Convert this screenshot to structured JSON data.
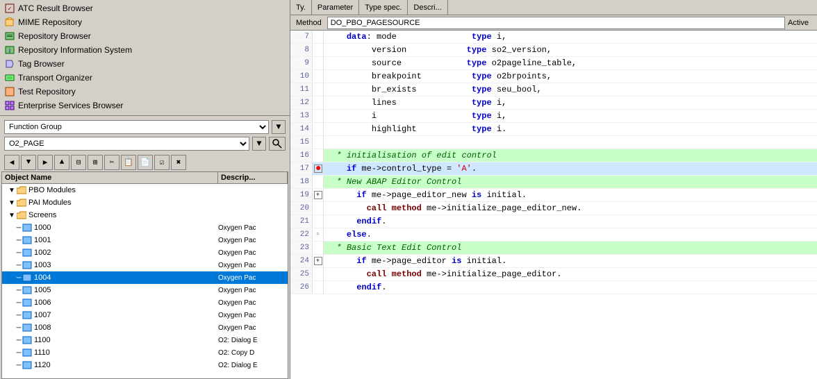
{
  "nav": {
    "items": [
      {
        "id": "atc",
        "label": "ATC Result Browser",
        "icon": "✓"
      },
      {
        "id": "mime",
        "label": "MIME Repository",
        "icon": "📁"
      },
      {
        "id": "repo",
        "label": "Repository Browser",
        "icon": "🗄"
      },
      {
        "id": "repoinfo",
        "label": "Repository Information System",
        "icon": "ℹ"
      },
      {
        "id": "tag",
        "label": "Tag Browser",
        "icon": "🏷"
      },
      {
        "id": "transport",
        "label": "Transport Organizer",
        "icon": "📦"
      },
      {
        "id": "test",
        "label": "Test Repository",
        "icon": "🧪"
      },
      {
        "id": "enterprise",
        "label": "Enterprise Services Browser",
        "icon": "⚙"
      }
    ]
  },
  "filter": {
    "type_label": "Function Group",
    "type_value": "Function Group",
    "object_value": "O2_PAGE",
    "search_label": "🔍"
  },
  "toolbar": {
    "buttons": [
      "◀",
      "▶",
      "▲",
      "▼",
      "⊟",
      "⊞",
      "📋",
      "⊞",
      "🗑"
    ]
  },
  "tree": {
    "col_name": "Object Name",
    "col_desc": "Descrip...",
    "items": [
      {
        "level": 1,
        "expand": true,
        "icon": "📁",
        "label": "PBO Modules",
        "desc": "",
        "type": "folder"
      },
      {
        "level": 1,
        "expand": true,
        "icon": "📁",
        "label": "PAI Modules",
        "desc": "",
        "type": "folder"
      },
      {
        "level": 1,
        "expand": true,
        "icon": "📁",
        "label": "Screens",
        "desc": "",
        "type": "folder"
      },
      {
        "level": 2,
        "expand": false,
        "icon": "📄",
        "label": "1000",
        "desc": "Oxygen Pac",
        "type": "item"
      },
      {
        "level": 2,
        "expand": false,
        "icon": "📄",
        "label": "1001",
        "desc": "Oxygen Pac",
        "type": "item"
      },
      {
        "level": 2,
        "expand": false,
        "icon": "📄",
        "label": "1002",
        "desc": "Oxygen Pac",
        "type": "item"
      },
      {
        "level": 2,
        "expand": false,
        "icon": "📄",
        "label": "1003",
        "desc": "Oxygen Pac",
        "type": "item"
      },
      {
        "level": 2,
        "expand": false,
        "icon": "📄",
        "label": "1004",
        "desc": "Oxygen Pac",
        "type": "item",
        "selected": true
      },
      {
        "level": 2,
        "expand": false,
        "icon": "📄",
        "label": "1005",
        "desc": "Oxygen Pac",
        "type": "item"
      },
      {
        "level": 2,
        "expand": false,
        "icon": "📄",
        "label": "1006",
        "desc": "Oxygen Pac",
        "type": "item"
      },
      {
        "level": 2,
        "expand": false,
        "icon": "📄",
        "label": "1007",
        "desc": "Oxygen Pac",
        "type": "item"
      },
      {
        "level": 2,
        "expand": false,
        "icon": "📄",
        "label": "1008",
        "desc": "Oxygen Pac",
        "type": "item"
      },
      {
        "level": 2,
        "expand": false,
        "icon": "📄",
        "label": "1100",
        "desc": "O2: Dialog E",
        "type": "item"
      },
      {
        "level": 2,
        "expand": false,
        "icon": "📄",
        "label": "1110",
        "desc": "O2: Copy D",
        "type": "item"
      },
      {
        "level": 2,
        "expand": false,
        "icon": "📄",
        "label": "1120",
        "desc": "O2: Dialog E",
        "type": "item"
      }
    ]
  },
  "editor": {
    "tabs": [
      {
        "id": "ty",
        "label": "Ty."
      },
      {
        "id": "param",
        "label": "Parameter"
      },
      {
        "id": "typespec",
        "label": "Type spec."
      },
      {
        "id": "descri",
        "label": "Descri..."
      }
    ],
    "method_label": "Method",
    "method_value": "DO_PBO_PAGESOURCE",
    "active_label": "Active",
    "lines": [
      {
        "num": "7",
        "fold": "",
        "content": "    <kw>data</kw>: mode               <kw>type</kw> i,"
      },
      {
        "num": "8",
        "fold": "",
        "content": "         version            <kw>type</kw> so2_version,"
      },
      {
        "num": "9",
        "fold": "",
        "content": "         source             <kw>type</kw> o2pageline_table,"
      },
      {
        "num": "10",
        "fold": "",
        "content": "         breakpoint          <kw>type</kw> o2brpoints,"
      },
      {
        "num": "11",
        "fold": "",
        "content": "         br_exists           <kw>type</kw> seu_bool,"
      },
      {
        "num": "12",
        "fold": "",
        "content": "         lines               <kw>type</kw> i,"
      },
      {
        "num": "13",
        "fold": "",
        "content": "         i                   <kw>type</kw> i,"
      },
      {
        "num": "14",
        "fold": "",
        "content": "         highlight           <kw>type</kw> i."
      },
      {
        "num": "15",
        "fold": "",
        "content": ""
      },
      {
        "num": "16",
        "fold": "",
        "content": "  * initialisation of edit control",
        "style": "comment"
      },
      {
        "num": "17",
        "fold": "-",
        "content": "    <kw>if</kw> me->control_type = <str>'A'</str>.",
        "error": true
      },
      {
        "num": "18",
        "fold": "",
        "content": "  * New ABAP Editor Control",
        "style": "comment"
      },
      {
        "num": "19",
        "fold": "+",
        "content": "      <kw>if</kw> me->page_editor_new <kw>is</kw> initial."
      },
      {
        "num": "20",
        "fold": "",
        "content": "        <kw>call method</kw> me->initialize_page_editor_new."
      },
      {
        "num": "21",
        "fold": "",
        "content": "      <kw>endif</kw>."
      },
      {
        "num": "22",
        "fold": ".",
        "content": "    <kw>else</kw>."
      },
      {
        "num": "23",
        "fold": "",
        "content": "  * Basic Text Edit Control",
        "style": "comment"
      },
      {
        "num": "24",
        "fold": "+",
        "content": "      <kw>if</kw> me->page_editor <kw>is</kw> initial."
      },
      {
        "num": "25",
        "fold": "",
        "content": "        <kw>call method</kw> me->initialize_page_editor."
      },
      {
        "num": "26",
        "fold": "",
        "content": "      <kw>endif</kw>."
      }
    ]
  }
}
